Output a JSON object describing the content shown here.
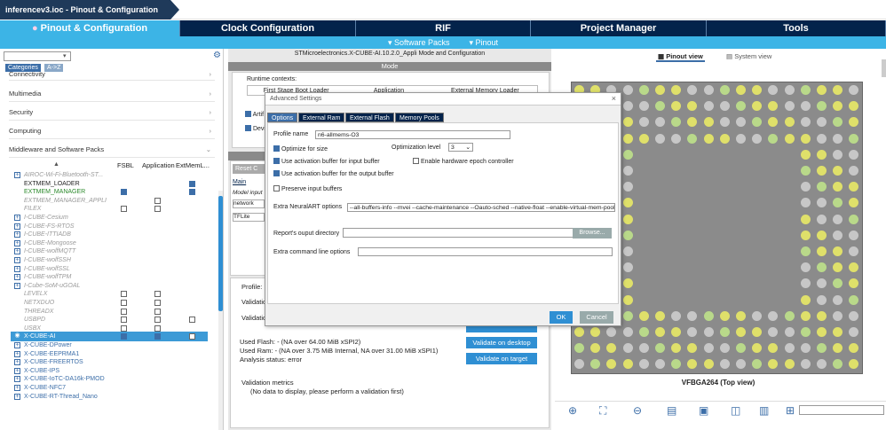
{
  "window": {
    "crumb": "inferencev3.ioc - Pinout & Configuration"
  },
  "main_tabs": [
    "Pinout & Configuration",
    "Clock Configuration",
    "RIF",
    "Project Manager",
    "Tools"
  ],
  "sub_tabs": [
    "Software Packs",
    "Pinout"
  ],
  "left": {
    "tabs": [
      "Categories",
      "A->Z"
    ],
    "categories": [
      "Connectivity",
      "Multimedia",
      "Security",
      "Computing",
      "Middleware and Software Packs"
    ],
    "columns": [
      "FSBL",
      "Application",
      "ExtMemL..."
    ],
    "rows": [
      {
        "name": "AIROC-Wi-Fi-Bluetooth-ST...",
        "style": "grey",
        "plus": true
      },
      {
        "name": "EXTMEM_LOADER",
        "style": "normal"
      },
      {
        "name": "EXTMEM_MANAGER",
        "style": "green"
      },
      {
        "name": "EXTMEM_MANAGER_APPLI",
        "style": "grey"
      },
      {
        "name": "FILEX",
        "style": "grey"
      },
      {
        "name": "I-CUBE-Cesium",
        "style": "grey",
        "plus": true
      },
      {
        "name": "I-CUBE-FS-RTOS",
        "style": "grey",
        "plus": true
      },
      {
        "name": "I-CUBE-ITTIADB",
        "style": "grey",
        "plus": true
      },
      {
        "name": "I-CUBE-Mongoose",
        "style": "grey",
        "plus": true
      },
      {
        "name": "I-CUBE-wolfMQTT",
        "style": "grey",
        "plus": true
      },
      {
        "name": "I-CUBE-wolfSSH",
        "style": "grey",
        "plus": true
      },
      {
        "name": "I-CUBE-wolfSSL",
        "style": "grey",
        "plus": true
      },
      {
        "name": "I-CUBE-wolfTPM",
        "style": "grey",
        "plus": true
      },
      {
        "name": "I-Cube-SoM-uGOAL",
        "style": "grey",
        "plus": true
      },
      {
        "name": "LEVELX",
        "style": "grey"
      },
      {
        "name": "NETXDUO",
        "style": "grey"
      },
      {
        "name": "THREADX",
        "style": "grey"
      },
      {
        "name": "USBPD",
        "style": "grey"
      },
      {
        "name": "USBX",
        "style": "grey"
      },
      {
        "name": "X-CUBE-AI",
        "style": "sel"
      },
      {
        "name": "X-CUBE-DPower",
        "style": "blue",
        "plus": true
      },
      {
        "name": "X-CUBE-EEPRMA1",
        "style": "blue",
        "plus": true
      },
      {
        "name": "X-CUBE-FREERTOS",
        "style": "blue",
        "plus": true
      },
      {
        "name": "X-CUBE-IPS",
        "style": "blue",
        "plus": true
      },
      {
        "name": "X-CUBE-IoTC-DA16k-PMOD",
        "style": "blue",
        "plus": true
      },
      {
        "name": "X-CUBE-NFC7",
        "style": "blue",
        "plus": true
      },
      {
        "name": "X-CUBE-RT-Thread_Nano",
        "style": "blue",
        "plus": true
      }
    ]
  },
  "mid": {
    "title": "STMicroelectronics.X-CUBE-AI.10.2.0_Appli Mode and Configuration",
    "mode": "Mode",
    "runtime_label": "Runtime contexts:",
    "runtime_cols": [
      "First Stage Boot Loader",
      "Application",
      "External Memory Loader"
    ],
    "artif": "Artif",
    "devic": "Devic",
    "reset": "Reset C",
    "main_tab": "Main",
    "model_input": "Model input",
    "network": "network",
    "tflite": "TFLite",
    "profile": "Profile:",
    "validation1": "Validation",
    "validation2": "Validation",
    "used_flash": "Used Flash: - (NA over 64.00 MiB xSPI2)",
    "used_ram": "Used Ram: - (NA over 3.75 MiB Internal, NA over 31.00 MiB xSPI1)",
    "analysis": "Analysis status: error",
    "btn_desktop": "Validate on desktop",
    "btn_target": "Validate on target",
    "metrics": "Validation metrics",
    "no_data": "(No data to display, please perform a validation first)"
  },
  "dialog": {
    "title": "Advanced Settings",
    "close": "×",
    "tabs": [
      "Options",
      "External Ram",
      "External Flash",
      "Memory Pools"
    ],
    "profile_label": "Profile name",
    "profile_value": "n6-allmems-O3",
    "optimize": "Optimize for size",
    "opt_level_label": "Optimization level",
    "opt_level_value": "3",
    "use_in": "Use activation buffer for input buffer",
    "epoch": "Enable hardware epoch controller",
    "use_out": "Use activation buffer for the output buffer",
    "preserve": "Preserve input buffers",
    "neural_label": "Extra NeuralART options",
    "neural_value": "--all-buffers-info --mvei --cache-maintenance --Oauto-sched --native-float --enable-virtual-mem-pools",
    "report_label": "Report's ouput directory",
    "browse": "Browse...",
    "extra_cmd": "Extra command line options",
    "ok": "OK",
    "cancel": "Cancel"
  },
  "right": {
    "pinout_view": "Pinout view",
    "system_view": "System view",
    "package": "VFBGA264 (Top view)"
  }
}
